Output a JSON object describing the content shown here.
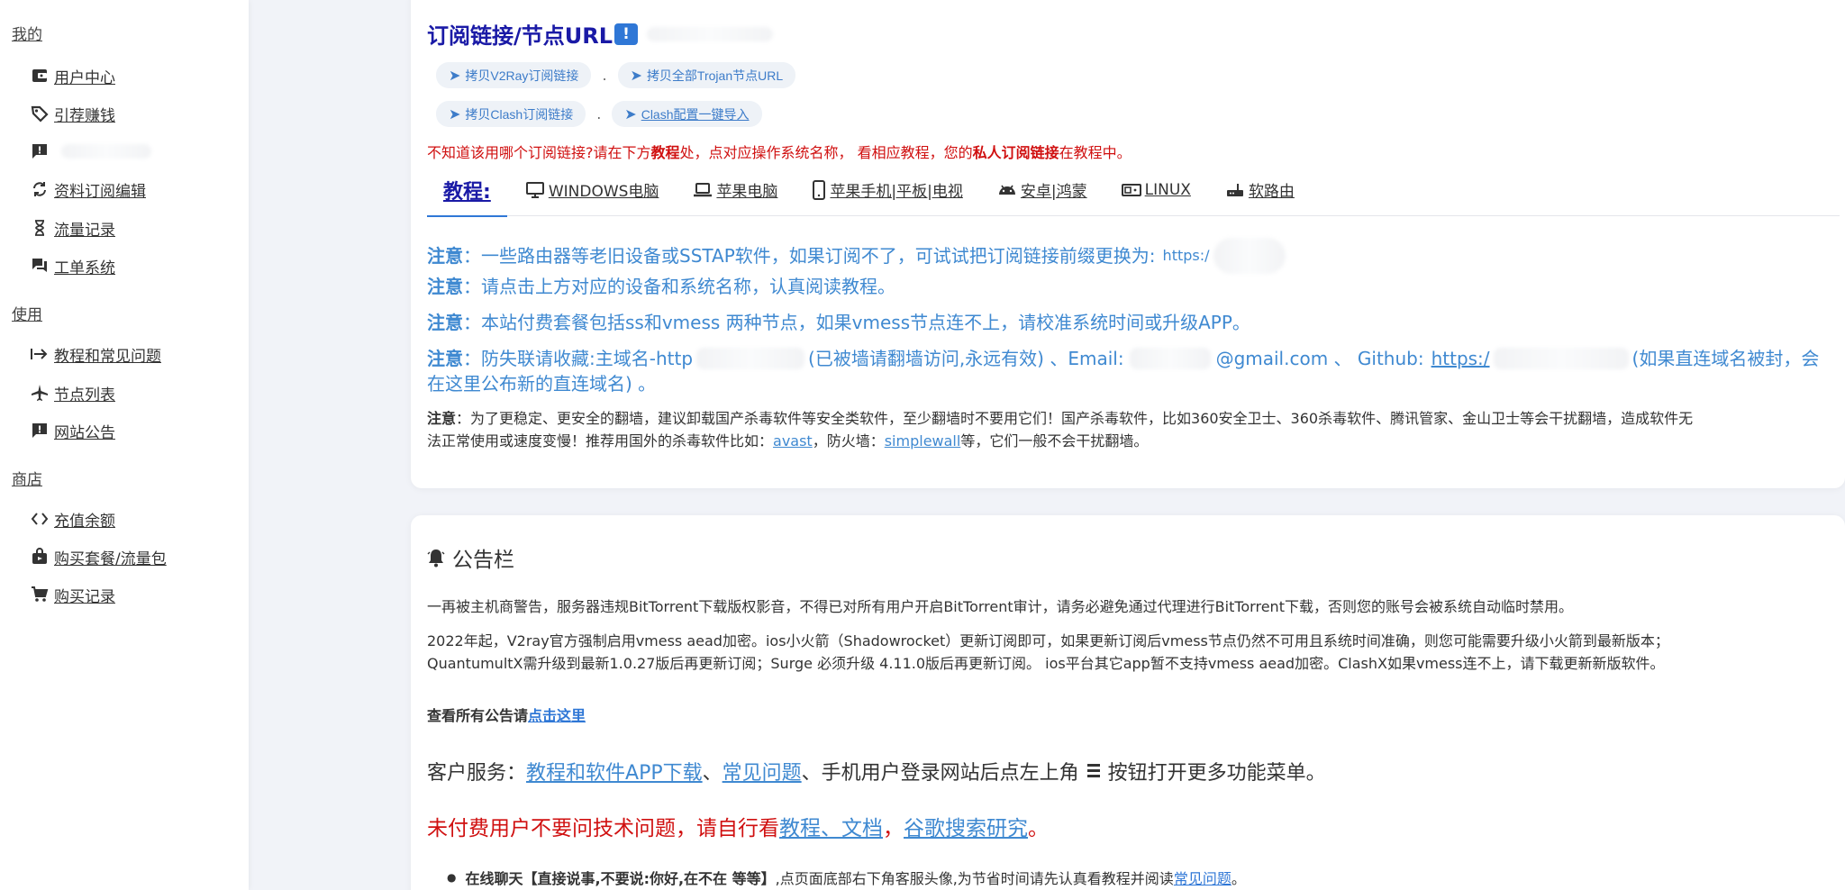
{
  "sidebar": {
    "sections": [
      {
        "label": "我的"
      },
      {
        "label": "使用"
      },
      {
        "label": "商店"
      }
    ],
    "items": [
      {
        "label": "用户中心",
        "icon": "wallet-icon"
      },
      {
        "label": "引荐赚钱",
        "icon": "tag-icon"
      },
      {
        "label": "",
        "icon": "alert-message-icon"
      },
      {
        "label": "资料订阅编辑",
        "icon": "sync-icon"
      },
      {
        "label": "流量记录",
        "icon": "hourglass-icon"
      },
      {
        "label": "工单系统",
        "icon": "chat-icon"
      },
      {
        "label": "教程和常见问题",
        "icon": "arrow-to-line-icon"
      },
      {
        "label": "节点列表",
        "icon": "airplane-icon"
      },
      {
        "label": "网站公告",
        "icon": "alert-message-icon"
      },
      {
        "label": "充值余额",
        "icon": "code-icon"
      },
      {
        "label": "购买套餐/流量包",
        "icon": "shopping-bag-icon"
      },
      {
        "label": "购买记录",
        "icon": "cart-icon"
      }
    ]
  },
  "subscription": {
    "title": "订阅链接/节点URL",
    "title_badge": "!",
    "buttons": [
      {
        "label": "拷贝V2Ray订阅链接"
      },
      {
        "label": "拷贝全部Trojan节点URL"
      },
      {
        "label": "拷贝Clash订阅链接"
      },
      {
        "label": "Clash配置一键导入"
      }
    ],
    "separator": ".",
    "warning": {
      "part1": "不知道该用哪个订阅链接?请在下方",
      "bold1": "教程",
      "part2": "处，点对应操作系统名称， 看相应教程，您的",
      "bold2": "私人订阅链接",
      "part3": "在教程中。"
    }
  },
  "tabs": [
    {
      "label": "教程:",
      "icon": ""
    },
    {
      "label": "WINDOWS电脑",
      "icon": "monitor-icon"
    },
    {
      "label": "苹果电脑",
      "icon": "laptop-icon"
    },
    {
      "label": "苹果手机|平板|电视",
      "icon": "phone-icon"
    },
    {
      "label": "安卓|鸿蒙",
      "icon": "android-icon"
    },
    {
      "label": "LINUX",
      "icon": "terminal-icon"
    },
    {
      "label": "软路由",
      "icon": "router-icon"
    }
  ],
  "notes": {
    "label": "注意",
    "n1": "：一些路由器等老旧设备或SSTAP软件，如果订阅不了，可试试把订阅链接前缀更换为:",
    "n1_prefix": "https:/",
    "n2": "：请点击上方对应的设备和系统名称，认真阅读教程。",
    "n3": "：本站付费套餐包括ss和vmess 两种节点，如果vmess节点连不上，请校准系统时间或升级APP。",
    "n4_a": "：防失联请收藏:主域名-http",
    "n4_b": "(已被墙请翻墙访问,永远有效) 、Email:",
    "n4_c": "@gmail.com 、 Github:",
    "n4_link": "https:/",
    "n4_d": "(如果直连域名被封，会",
    "n4_e": "在这里公布新的直连域名) 。",
    "n5_a": "：为了更稳定、更安全的翻墙，建议卸载国产杀毒软件等安全类软件，至少翻墙时不要用它们！国产杀毒软件，比如360安全卫士、360杀毒软件、腾讯管家、金山卫士等会干扰翻墙，造成软件无",
    "n5_b": "法正常使用或速度变慢！推荐用国外的杀毒软件比如：",
    "n5_link1": "avast",
    "n5_c": "，防火墙：",
    "n5_link2": "simplewall",
    "n5_d": "等，它们一般不会干扰翻墙。"
  },
  "announcement": {
    "title": "公告栏",
    "p1": "一再被主机商警告，服务器违规BitTorrent下载版权影音，不得已对所有用户开启BitTorrent审计，请务必避免通过代理进行BitTorrent下载，否则您的账号会被系统自动临时禁用。",
    "p2a": "2022年起，V2ray官方强制启用vmess aead加密。ios小火箭（Shadowrocket）更新订阅即可，如果更新订阅后vmess节点仍然不可用且系统时间准确，则您可能需要升级小火箭到最新版本；",
    "p2b": "QuantumultX需升级到最新1.0.27版后再更新订阅；Surge 必须升级 4.11.0版后再更新订阅。 ios平台其它app暂不支持vmess aead加密。ClashX如果vmess连不上，请下载更新新版软件。",
    "view_all": "查看所有公告请",
    "view_all_link": "点击这里",
    "service_a": "客户服务：",
    "service_link1": "教程和软件APP下载",
    "service_b": "、",
    "service_link2": "常见问题",
    "service_c": "、手机用户登录网站后点左上角",
    "service_d": "按钮打开更多功能菜单。",
    "unpaid_a": "未付费用户不要问技术问题，请自行看",
    "unpaid_link1": "教程、文档",
    "unpaid_b": "，",
    "unpaid_link2": "谷歌搜索研究",
    "unpaid_c": "。",
    "chat_bold": "在线聊天【直接说事,不要说:你好,在不在 等等】",
    "chat_text": ",点页面底部右下角客服头像,为节省时间请先认真看教程并阅读",
    "chat_link": "常见问题",
    "chat_end": "。"
  }
}
